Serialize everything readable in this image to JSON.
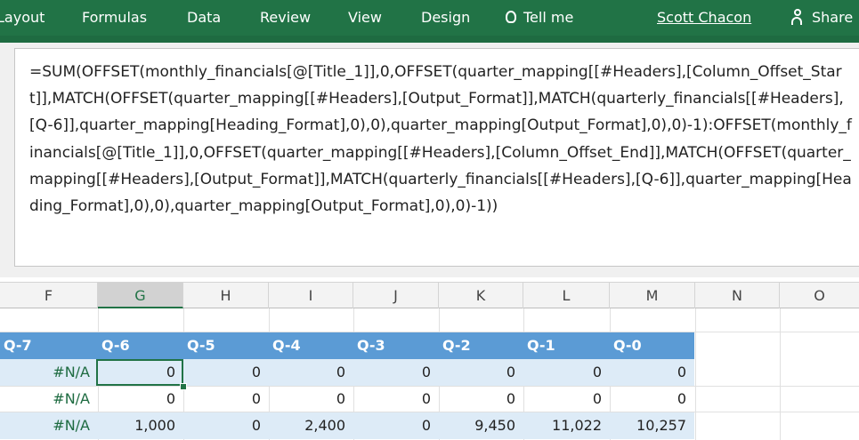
{
  "ribbon": {
    "tabs": [
      "Layout",
      "Formulas",
      "Data",
      "Review",
      "View",
      "Design"
    ],
    "tell_me": "Tell me",
    "user": "Scott Chacon",
    "share": "Share",
    "background_color": "#217346",
    "tell_me_icon": "lightbulb-icon",
    "share_icon": "person-add-icon"
  },
  "formula_bar": {
    "formula": "=SUM(OFFSET(monthly_financials[@[Title_1]],0,OFFSET(quarter_mapping[[#Headers],[Column_Offset_Start]],MATCH(OFFSET(quarter_mapping[[#Headers],[Output_Format]],MATCH(quarterly_financials[[#Headers],[Q-6]],quarter_mapping[Heading_Format],0),0),quarter_mapping[Output_Format],0),0)-1):OFFSET(monthly_financials[@[Title_1]],0,OFFSET(quarter_mapping[[#Headers],[Column_Offset_End]],MATCH(OFFSET(quarter_mapping[[#Headers],[Output_Format]],MATCH(quarterly_financials[[#Headers],[Q-6]],quarter_mapping[Heading_Format],0),0),quarter_mapping[Output_Format],0),0)-1))"
  },
  "grid": {
    "columns": [
      "F",
      "G",
      "H",
      "I",
      "J",
      "K",
      "L",
      "M",
      "N",
      "O"
    ],
    "selected_column": "G",
    "table_headers": [
      "Q-7",
      "Q-6",
      "Q-5",
      "Q-4",
      "Q-3",
      "Q-2",
      "Q-1",
      "Q-0"
    ],
    "rows": [
      [
        "#N/A",
        "0",
        "0",
        "0",
        "0",
        "0",
        "0",
        "0"
      ],
      [
        "#N/A",
        "0",
        "0",
        "0",
        "0",
        "0",
        "0",
        "0"
      ],
      [
        "#N/A",
        "1,000",
        "0",
        "2,400",
        "0",
        "9,450",
        "11,022",
        "10,257"
      ]
    ],
    "header_color": "#5b9bd5",
    "band_color": "#ddebf7",
    "active_cell": "G"
  }
}
